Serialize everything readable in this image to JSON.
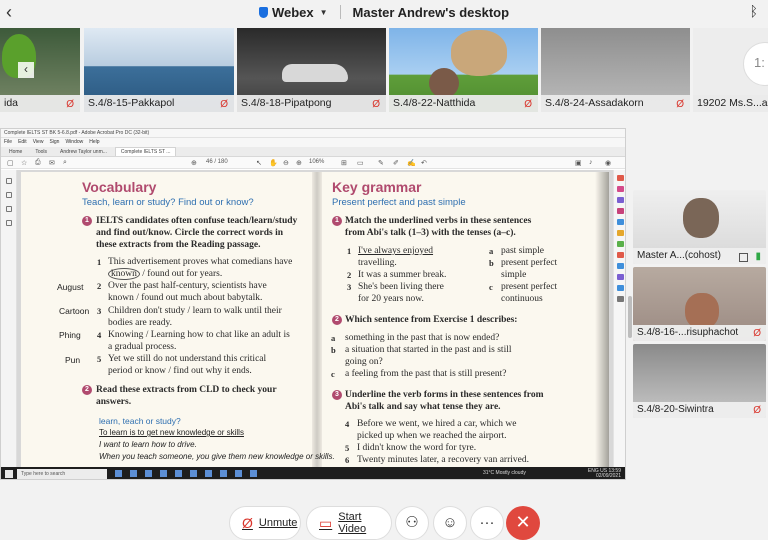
{
  "topbar": {
    "back_icon": "‹",
    "app_name": "Webex",
    "title": "Master Andrew's desktop",
    "bluetooth_icon": "ᛒ"
  },
  "strip": [
    {
      "name": "ida"
    },
    {
      "name": "S.4/8-15-Pakkapol"
    },
    {
      "name": "S.4/8-18-Pipatpong"
    },
    {
      "name": "S.4/8-22-Natthida"
    },
    {
      "name": "S.4/8-24-Assadakorn"
    },
    {
      "name": "19202 Ms.S...al"
    }
  ],
  "strip_nav_icon": "‹",
  "strip_extra_glyph": "1:",
  "acrobat": {
    "title": "Complete IELTS ST BK 5-6.8.pdf - Adobe Acrobat Pro DC (32-bit)",
    "menu": [
      "File",
      "Edit",
      "View",
      "Sign",
      "Window",
      "Help"
    ],
    "tabs": [
      "Home",
      "Tools",
      "Andrew Taylor unm...",
      "Complete IELTS ST ..."
    ],
    "page_indicator": "46 / 180",
    "zoom": "106%"
  },
  "vocab": {
    "heading": "Vocabulary",
    "subheading": "Teach, learn or study? Find out or know?",
    "ex1_num": "1",
    "ex1_instruction_l1": "IELTS candidates often confuse teach/learn/study",
    "ex1_instruction_l2": "and find out/know. Circle the correct words in",
    "ex1_instruction_l3": "these extracts from the Reading passage.",
    "items": [
      {
        "n": "1",
        "l1": "This advertisement proves what comedians have",
        "l2a": "known",
        "l2b": "/ found out for years."
      },
      {
        "n": "2",
        "l1": "Over the past half-century, scientists have",
        "l2": "known / found out much about babytalk."
      },
      {
        "n": "3",
        "l1": "Children don't study / learn to walk until their",
        "l2": "bodies are ready."
      },
      {
        "n": "4",
        "l1": "Knowing / Learning how to chat like an adult is",
        "l2": "a gradual process."
      },
      {
        "n": "5",
        "l1": "Yet we still do not understand this critical",
        "l2": "period or know / find out why it ends."
      }
    ],
    "notes": [
      "August",
      "Cartoon",
      "Phing",
      "Pun"
    ],
    "ex2_num": "2",
    "ex2_instruction_l1": "Read these extracts from CLD to check your",
    "ex2_instruction_l2": "answers.",
    "box_title": "learn, teach or study?",
    "box_l1": "To learn is to get new knowledge or skills",
    "box_l2": "I want to learn how to drive.",
    "box_l3": "When you teach someone, you give them new knowledge or skills."
  },
  "grammar": {
    "heading": "Key grammar",
    "subheading": "Present perfect and past simple",
    "ex1_num": "1",
    "ex1_l1": "Match the underlined verbs in these sentences",
    "ex1_l2": "from Abi's talk (1–3) with the tenses (a–c).",
    "left": [
      {
        "n": "1",
        "l1": "I've always enjoyed",
        "l2": "travelling."
      },
      {
        "n": "2",
        "l1": "It was a summer break."
      },
      {
        "n": "3",
        "l1": "She's been living there",
        "l2": "for 20 years now."
      }
    ],
    "right": [
      {
        "n": "a",
        "l1": "past simple"
      },
      {
        "n": "b",
        "l1": "present perfect",
        "l2": "simple"
      },
      {
        "n": "c",
        "l1": "present perfect",
        "l2": "continuous"
      }
    ],
    "ex2_num": "2",
    "ex2_l1": "Which sentence from Exercise 1 describes:",
    "ex2_items": [
      {
        "n": "a",
        "l1": "something in the past that is now ended?"
      },
      {
        "n": "b",
        "l1": "a situation that started in the past and is still",
        "l2": "going on?"
      },
      {
        "n": "c",
        "l1": "a feeling from the past that is still present?"
      }
    ],
    "ex3_num": "3",
    "ex3_l1": "Underline the verb forms in these sentences from",
    "ex3_l2": "Abi's talk and say what tense they are.",
    "ex3_items": [
      {
        "n": "4",
        "l1": "Before we went, we hired a car, which we",
        "l2": "picked up when we reached the airport."
      },
      {
        "n": "5",
        "l1": "I didn't know the word for tyre."
      },
      {
        "n": "6",
        "l1": "Twenty minutes later, a recovery van arrived."
      }
    ]
  },
  "taskbar": {
    "search_placeholder": "Type here to search",
    "weather": "31°C  Mostly cloudy",
    "lang": "ENG US",
    "time": "13:59",
    "date": "02/09/2021"
  },
  "participants": [
    {
      "name": "Master A...(cohost)"
    },
    {
      "name": "S.4/8-16-...risuphachot"
    },
    {
      "name": "S.4/8-20-Siwintra"
    }
  ],
  "controls": {
    "unmute_label": "Unmute",
    "start_video_label": "Start Video",
    "more_icon": "···",
    "end_icon": "✕"
  },
  "colors": {
    "accent": "#b04a6e",
    "link_blue": "#2e6fb0",
    "end_red": "#e0483e",
    "muted_red": "#d9342b"
  }
}
